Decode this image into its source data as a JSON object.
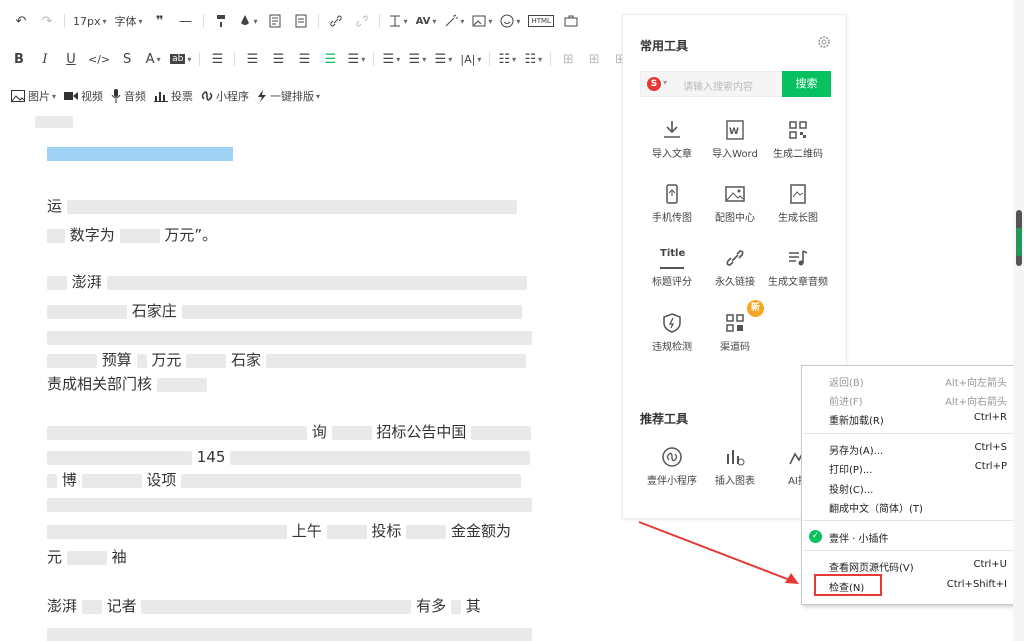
{
  "toolbar": {
    "row1": {
      "undo": "↶",
      "redo": "↷",
      "font_size": "17px",
      "font_label": "字体",
      "quote": "❝❞",
      "hr": "—"
    },
    "row3": {
      "image": "图片",
      "video": "视频",
      "audio": "音频",
      "vote": "投票",
      "miniprogram": "小程序",
      "oneclick": "一键排版"
    }
  },
  "editor": {
    "p1_line1": "运",
    "p1_line2": "数字为",
    "p1_tail": "万元”。",
    "p2_l1": "澎湃",
    "p2_l3": "石家庄",
    "p2_l4_a": "预算",
    "p2_l4_b": "万元",
    "p2_l4_c": "石家",
    "p2_l5": "责成相关部门核",
    "p3_l1": "询",
    "p3_l1b": "招标公告中国",
    "p3_l2": "145",
    "p3_l3": "博",
    "p3_l3b": "设项",
    "p4_l1": "上午",
    "p4_l1b": "投标",
    "p4_l1c": "金金额为",
    "p4_l2": "元",
    "p4_l2b": "袖",
    "p5_l1": "澎湃",
    "p5_l1b": "记者",
    "p5_l1c": "有多",
    "p5_l1d": "其"
  },
  "panel": {
    "common_title": "常用工具",
    "search_placeholder": "请输入搜索内容",
    "search_button": "搜索",
    "tools": [
      {
        "label": "导入文章",
        "icon": "import-icon"
      },
      {
        "label": "导入Word",
        "icon": "word-icon"
      },
      {
        "label": "生成二维码",
        "icon": "qrcode-icon"
      },
      {
        "label": "手机传图",
        "icon": "phone-icon"
      },
      {
        "label": "配图中心",
        "icon": "image-icon"
      },
      {
        "label": "生成长图",
        "icon": "long-image-icon"
      },
      {
        "label": "标题评分",
        "icon": "title-icon"
      },
      {
        "label": "永久链接",
        "icon": "link-icon"
      },
      {
        "label": "生成文章音频",
        "icon": "audio-note-icon"
      },
      {
        "label": "违规检测",
        "icon": "shield-icon"
      },
      {
        "label": "渠道码",
        "icon": "channel-qr-icon"
      }
    ],
    "new_badge": "新",
    "title_icon_text": "Title",
    "recommend_title": "推荐工具",
    "recommend": [
      {
        "label": "壹伴小程序",
        "icon": "mini-program-icon"
      },
      {
        "label": "插入图表",
        "icon": "chart-icon"
      },
      {
        "label": "AI搜",
        "icon": "ai-search-icon"
      }
    ]
  },
  "context_menu": {
    "items": [
      {
        "label": "返回(B)",
        "shortcut": "Alt+向左箭头",
        "disabled": true
      },
      {
        "label": "前进(F)",
        "shortcut": "Alt+向右箭头",
        "disabled": true
      },
      {
        "label": "重新加载(R)",
        "shortcut": "Ctrl+R",
        "disabled": false
      },
      {
        "label": "另存为(A)...",
        "shortcut": "Ctrl+S",
        "disabled": false
      },
      {
        "label": "打印(P)...",
        "shortcut": "Ctrl+P",
        "disabled": false
      },
      {
        "label": "投射(C)...",
        "shortcut": "",
        "disabled": false
      },
      {
        "label": "翻成中文（简体）(T)",
        "shortcut": "",
        "disabled": false
      },
      {
        "label": "壹伴 · 小插件",
        "shortcut": "",
        "disabled": false
      },
      {
        "label": "查看网页源代码(V)",
        "shortcut": "Ctrl+U",
        "disabled": false
      },
      {
        "label": "检查(N)",
        "shortcut": "Ctrl+Shift+I",
        "disabled": false
      }
    ]
  },
  "colors": {
    "accent_green": "#07c160",
    "highlight_red": "#e53935",
    "link_blue": "#7fc3f0",
    "badge_orange": "#f5a623"
  }
}
